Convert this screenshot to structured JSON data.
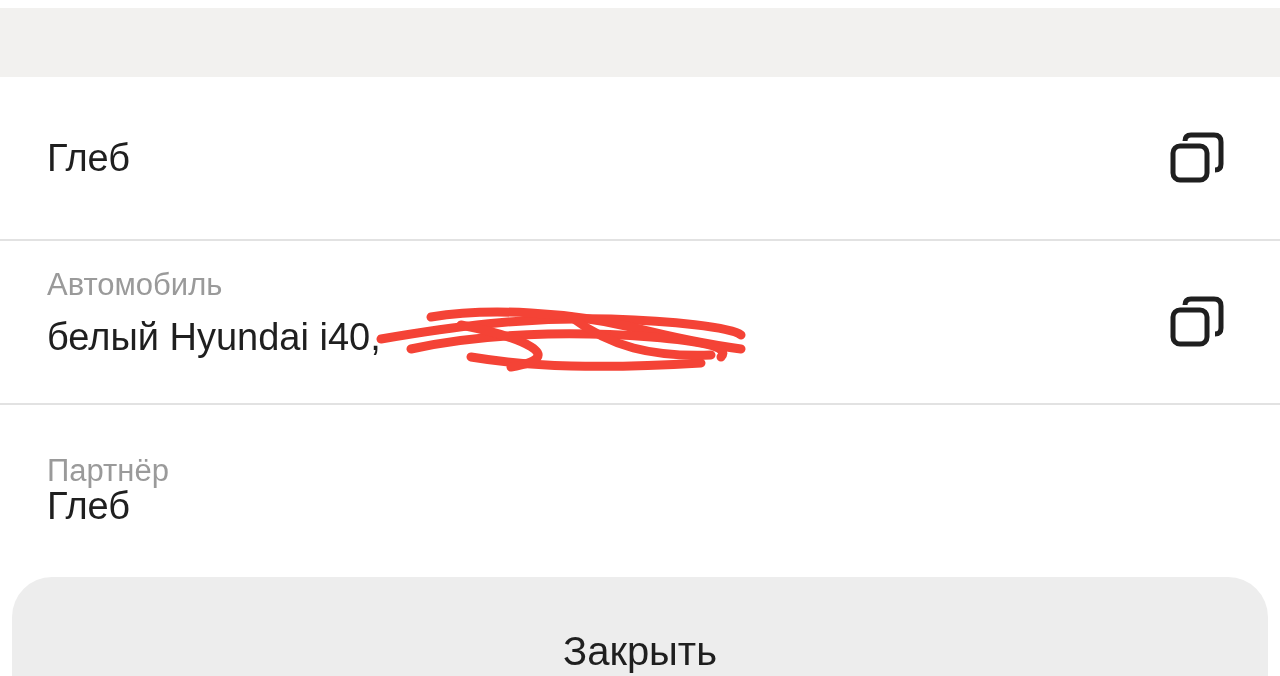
{
  "rows": [
    {
      "kind": "plain",
      "value": "Глеб",
      "copyable": true
    },
    {
      "kind": "labeled",
      "label": "Автомобиль",
      "value": "белый Hyundai i40,",
      "copyable": true,
      "redacted": true
    },
    {
      "kind": "labeled",
      "label": "Партнёр",
      "value": "Глеб",
      "copyable": false
    }
  ],
  "close_button": {
    "label": "Закрыть"
  }
}
